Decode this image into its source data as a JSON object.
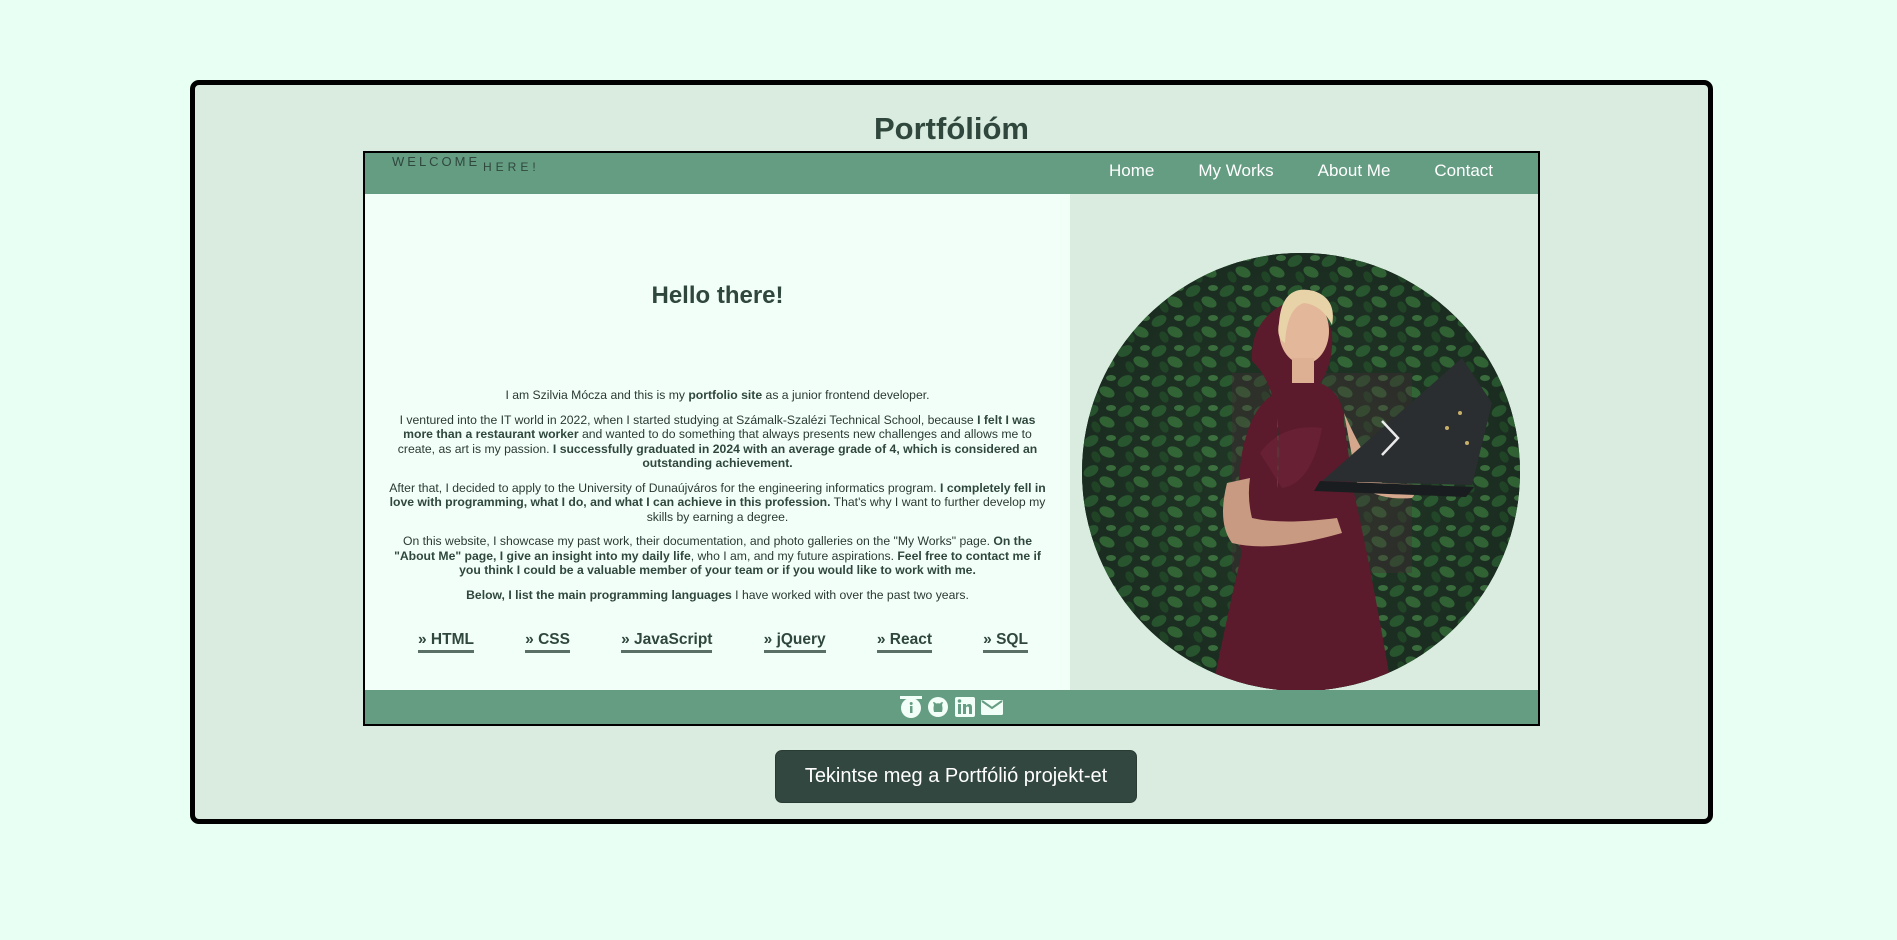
{
  "page": {
    "title": "Portfólióm",
    "cta_label": "Tekintse meg a Portfólió projekt-et"
  },
  "header": {
    "welcome_1": "WELCOME",
    "welcome_2": "HERE!",
    "nav": [
      "Home",
      "My Works",
      "About Me",
      "Contact"
    ]
  },
  "intro": {
    "heading": "Hello there!",
    "p1_a": "I am Szilvia Mócza and this is my ",
    "p1_b": "portfolio site",
    "p1_c": " as a junior frontend developer.",
    "p2_a": "I ventured into the IT world in 2022, when I started studying at Számalk-Szalézi Technical School, because ",
    "p2_b": "I felt I was more than a restaurant worker",
    "p2_c": " and wanted to do something that always presents new challenges and allows me to create, as art is my passion. ",
    "p2_d": "I successfully graduated in 2024 with an average grade of 4, which is considered an outstanding achievement.",
    "p3_a": "After that, I decided to apply to the University of Dunaújváros for the engineering informatics program. ",
    "p3_b": "I completely fell in love with programming, what I do, and what I can achieve in this profession.",
    "p3_c": " That's why I want to further develop my skills by earning a degree.",
    "p4_a": "On this website, I showcase my past work, their documentation, and photo galleries on the \"My Works\" page. ",
    "p4_b": "On the \"About Me\" page, I give an insight into my daily life",
    "p4_c": ", who I am, and my future aspirations. ",
    "p4_d": "Feel free to contact me if you think I could be a valuable member of your team or if you would like to work with me.",
    "p5_a": "Below, I list the main programming languages",
    "p5_b": " I have worked with over the past two years."
  },
  "languages": [
    "» HTML",
    "» CSS",
    "» JavaScript",
    "» jQuery",
    "» React",
    "» SQL"
  ],
  "footer": {
    "icons": [
      "info-icon",
      "github-icon",
      "linkedin-icon",
      "email-icon"
    ]
  },
  "colors": {
    "background": "#e8fff4",
    "card": "#d9ecdf",
    "nav": "#659d83",
    "text": "#2f473d",
    "button": "#32473f"
  }
}
